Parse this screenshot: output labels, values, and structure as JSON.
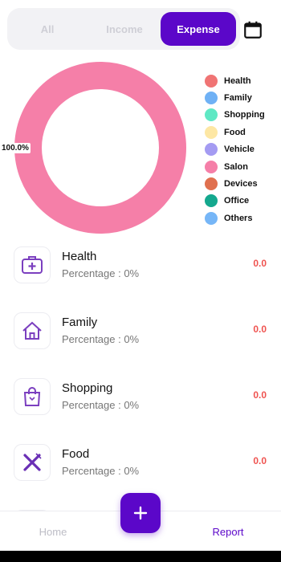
{
  "tabs": [
    {
      "label": "All",
      "active": false
    },
    {
      "label": "Income",
      "active": false
    },
    {
      "label": "Expense",
      "active": true
    }
  ],
  "chart_data": {
    "type": "pie",
    "categories": [
      "Health",
      "Family",
      "Shopping",
      "Food",
      "Vehicle",
      "Salon",
      "Devices",
      "Office",
      "Others"
    ],
    "values": [
      0,
      0,
      0,
      0,
      0,
      100,
      0,
      0,
      0
    ],
    "colors": [
      "#f07474",
      "#6fb1f5",
      "#5fe8c4",
      "#fde7a4",
      "#a49bf2",
      "#f57fa8",
      "#e0704f",
      "#14a88e",
      "#76b6f7"
    ],
    "data_label": "100.0%",
    "legend_position": "right"
  },
  "list": [
    {
      "title": "Health",
      "subtitle": "Percentage : 0%",
      "amount": "0.0",
      "icon": "medical-kit-icon"
    },
    {
      "title": "Family",
      "subtitle": "Percentage : 0%",
      "amount": "0.0",
      "icon": "home-icon"
    },
    {
      "title": "Shopping",
      "subtitle": "Percentage : 0%",
      "amount": "0.0",
      "icon": "shopping-bag-icon"
    },
    {
      "title": "Food",
      "subtitle": "Percentage : 0%",
      "amount": "0.0",
      "icon": "fork-knife-icon"
    }
  ],
  "nav": {
    "home": "Home",
    "report": "Report",
    "fab": "+"
  },
  "accent_color": "#5b07c9",
  "amount_color": "#ef5350"
}
